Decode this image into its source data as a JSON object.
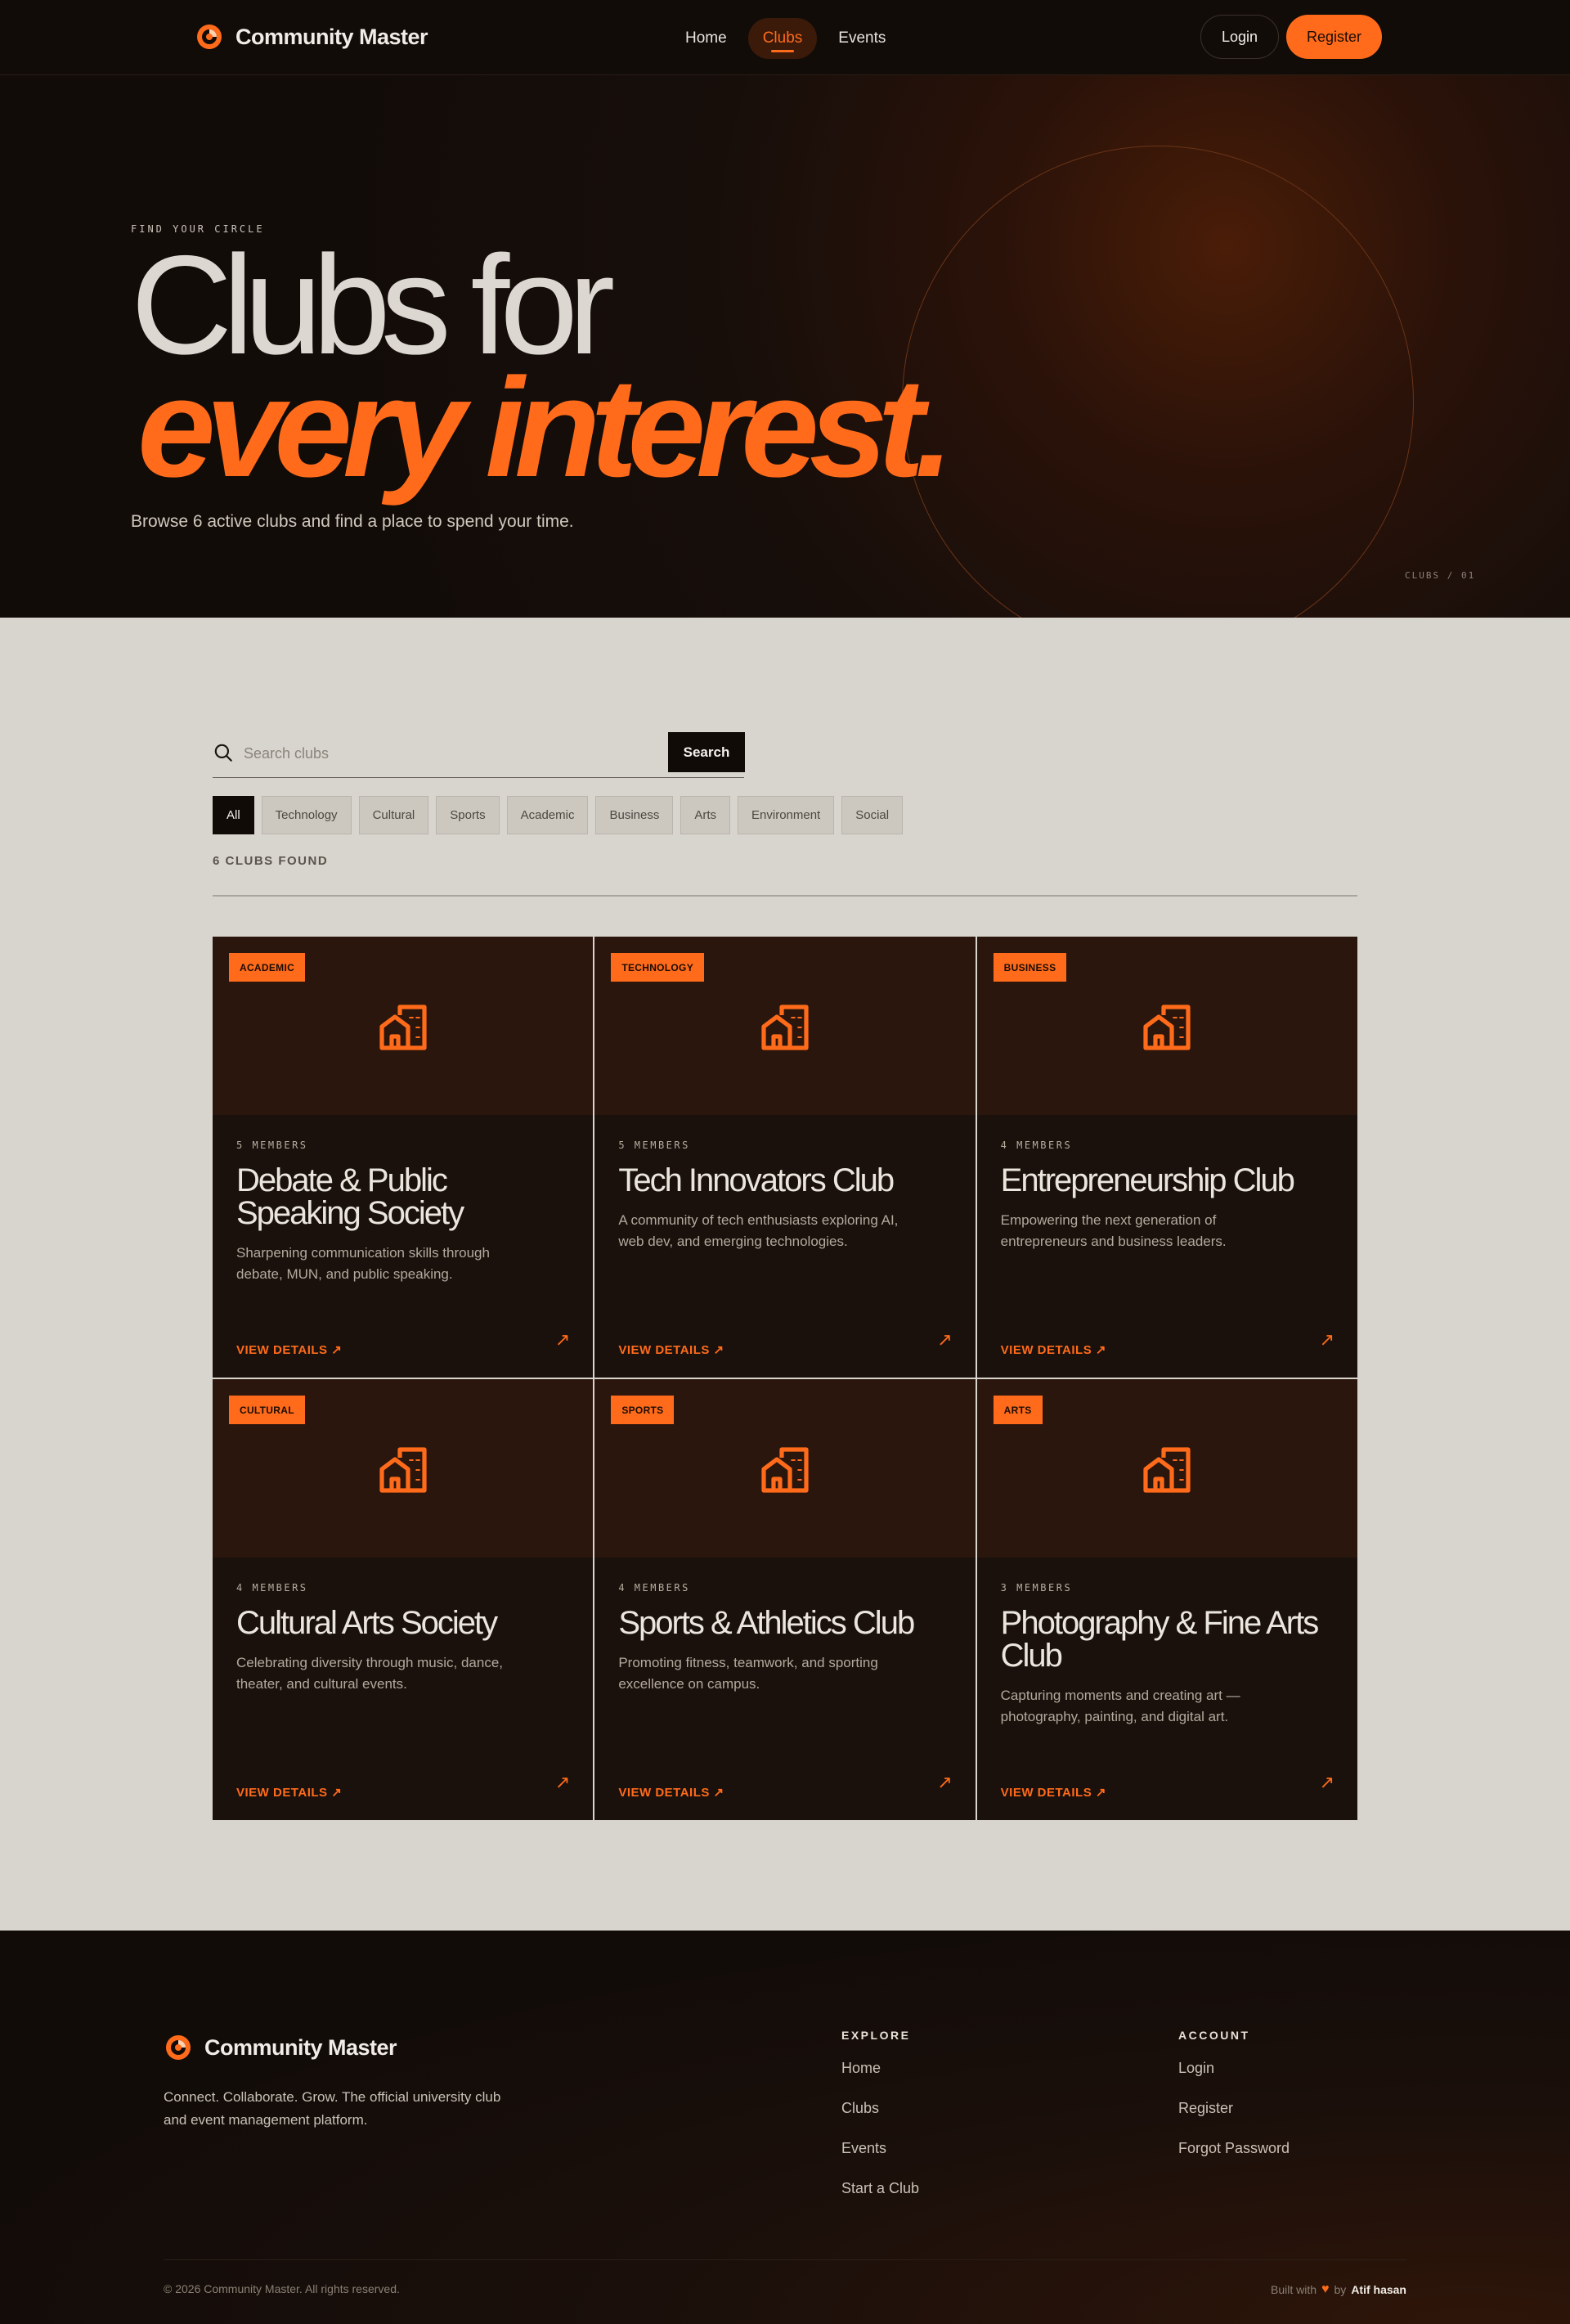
{
  "nav": {
    "brand": "Community Master",
    "links": [
      {
        "label": "Home"
      },
      {
        "label": "Clubs",
        "active": true
      },
      {
        "label": "Events"
      }
    ],
    "login": "Login",
    "register": "Register"
  },
  "hero": {
    "eyebrow": "FIND YOUR CIRCLE",
    "title_line1": "Clubs for",
    "title_line2": "every interest.",
    "description": "Browse 6 active clubs and find a place to spend your time.",
    "index": "CLUBS / 01"
  },
  "search": {
    "placeholder": "Search clubs",
    "button": "Search"
  },
  "filters": [
    "All",
    "Technology",
    "Cultural",
    "Sports",
    "Academic",
    "Business",
    "Arts",
    "Environment",
    "Social"
  ],
  "results_label": "6 CLUBS FOUND",
  "clubs": [
    {
      "badge": "ACADEMIC",
      "members": "5 MEMBERS",
      "name": "Debate & Public Speaking Society",
      "description": "Sharpening communication skills through debate, MUN, and public speaking.",
      "cta": "VIEW DETAILS ↗"
    },
    {
      "badge": "TECHNOLOGY",
      "members": "5 MEMBERS",
      "name": "Tech Innovators Club",
      "description": "A community of tech enthusiasts exploring AI, web dev, and emerging technologies.",
      "cta": "VIEW DETAILS ↗"
    },
    {
      "badge": "BUSINESS",
      "members": "4 MEMBERS",
      "name": "Entrepreneurship Club",
      "description": "Empowering the next generation of entrepreneurs and business leaders.",
      "cta": "VIEW DETAILS ↗"
    },
    {
      "badge": "CULTURAL",
      "members": "4 MEMBERS",
      "name": "Cultural Arts Society",
      "description": "Celebrating diversity through music, dance, theater, and cultural events.",
      "cta": "VIEW DETAILS ↗"
    },
    {
      "badge": "SPORTS",
      "members": "4 MEMBERS",
      "name": "Sports & Athletics Club",
      "description": "Promoting fitness, teamwork, and sporting excellence on campus.",
      "cta": "VIEW DETAILS ↗"
    },
    {
      "badge": "ARTS",
      "members": "3 MEMBERS",
      "name": "Photography & Fine Arts Club",
      "description": "Capturing moments and creating art — photography, painting, and digital art.",
      "cta": "VIEW DETAILS ↗"
    }
  ],
  "footer": {
    "brand": "Community Master",
    "description": "Connect. Collaborate. Grow. The official university club and event management platform.",
    "explore_title": "EXPLORE",
    "explore_links": [
      "Home",
      "Clubs",
      "Events",
      "Start a Club"
    ],
    "account_title": "ACCOUNT",
    "account_links": [
      "Login",
      "Register",
      "Forgot Password"
    ],
    "copyright": "© 2026 Community Master. All rights reserved.",
    "built_prefix": "Built with",
    "built_by": "by",
    "author": "Atif hasan"
  },
  "colors": {
    "accent": "#ff6b1a",
    "dark": "#120c09",
    "card": "#1a110d",
    "card_top": "#2b160d",
    "light_bg": "#d8d5ce"
  },
  "icons": {
    "logo": "logo-icon",
    "search": "search-icon",
    "club": "building-icon",
    "arrow": "arrow-up-right-icon",
    "heart": "heart-icon"
  }
}
